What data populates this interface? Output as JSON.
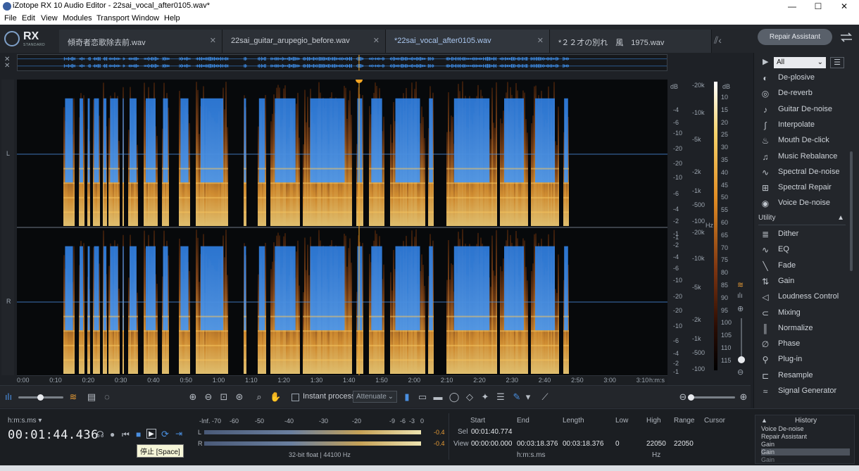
{
  "window": {
    "title": "iZotope RX 10 Audio Editor - 22sai_vocal_after0105.wav*",
    "minimize": "—",
    "maximize": "☐",
    "close": "✕"
  },
  "menu": [
    "File",
    "Edit",
    "View",
    "Modules",
    "Transport",
    "Window",
    "Help"
  ],
  "logo": {
    "text": "RX",
    "edition": "STANDARD"
  },
  "tabs": [
    {
      "label": "傾奇者恋歌除去前.wav",
      "active": false
    },
    {
      "label": "22sai_guitar_arupegio_before.wav",
      "active": false
    },
    {
      "label": "*22sai_vocal_after0105.wav",
      "active": true
    },
    {
      "label": "*２２才の別れ　風　1975.wav",
      "active": false
    }
  ],
  "repair_assistant": "Repair Assistant",
  "channels": {
    "left": "L",
    "right": "R"
  },
  "db_scale_label": "dB",
  "db_scale_top": [
    "-4",
    "-6",
    "-10",
    "-20",
    "-20",
    "-10",
    "-6",
    "-4",
    "-2",
    "-1"
  ],
  "db_scale_bottom": [
    "-1",
    "-2",
    "-4",
    "-6",
    "-10",
    "-20",
    "-20",
    "-10",
    "-6",
    "-4",
    "-2",
    "-1"
  ],
  "hz_scale_top": [
    "-20k",
    "-10k",
    "-5k",
    "-2k",
    "-1k",
    "-500",
    "-100"
  ],
  "hz_scale_bottom": [
    "-20k",
    "-10k",
    "-5k",
    "-2k",
    "-1k",
    "-500",
    "-100"
  ],
  "hz_unit": "Hz",
  "colorbar_label": "dB",
  "colorbar_ticks": [
    "10",
    "15",
    "20",
    "25",
    "30",
    "35",
    "40",
    "45",
    "50",
    "55",
    "60",
    "65",
    "70",
    "75",
    "80",
    "85",
    "90",
    "95",
    "100",
    "105",
    "110",
    "115"
  ],
  "timeline": [
    "0:00",
    "0:10",
    "0:20",
    "0:30",
    "0:40",
    "0:50",
    "1:00",
    "1:10",
    "1:20",
    "1:30",
    "1:40",
    "1:50",
    "2:00",
    "2:10",
    "2:20",
    "2:30",
    "2:40",
    "2:50",
    "3:00",
    "3:10"
  ],
  "timeline_unit": "h:m:s",
  "toolbar": {
    "instant_process": "Instant process",
    "attenuate": "Attenuate"
  },
  "modules_filter": "All",
  "modules": [
    {
      "name": "De-plosive",
      "icon": "deplosive-icon",
      "glyph": "◐"
    },
    {
      "name": "De-reverb",
      "icon": "dereverb-icon",
      "glyph": "◎"
    },
    {
      "name": "Guitar De-noise",
      "icon": "guitar-icon",
      "glyph": "♪"
    },
    {
      "name": "Interpolate",
      "icon": "interpolate-icon",
      "glyph": "∫"
    },
    {
      "name": "Mouth De-click",
      "icon": "mouth-icon",
      "glyph": "♨"
    },
    {
      "name": "Music Rebalance",
      "icon": "rebalance-icon",
      "glyph": "♫"
    },
    {
      "name": "Spectral De-noise",
      "icon": "spectral-denoise-icon",
      "glyph": "∿"
    },
    {
      "name": "Spectral Repair",
      "icon": "spectral-repair-icon",
      "glyph": "⊞"
    },
    {
      "name": "Voice De-noise",
      "icon": "voice-icon",
      "glyph": "◉"
    }
  ],
  "utility_header": "Utility",
  "utility_modules": [
    {
      "name": "Dither",
      "icon": "dither-icon",
      "glyph": "≣"
    },
    {
      "name": "EQ",
      "icon": "eq-icon",
      "glyph": "∿"
    },
    {
      "name": "Fade",
      "icon": "fade-icon",
      "glyph": "╲"
    },
    {
      "name": "Gain",
      "icon": "gain-icon",
      "glyph": "⇅"
    },
    {
      "name": "Loudness Control",
      "icon": "loudness-icon",
      "glyph": "◁"
    },
    {
      "name": "Mixing",
      "icon": "mixing-icon",
      "glyph": "⊂"
    },
    {
      "name": "Normalize",
      "icon": "normalize-icon",
      "glyph": "║"
    },
    {
      "name": "Phase",
      "icon": "phase-icon",
      "glyph": "∅"
    },
    {
      "name": "Plug-in",
      "icon": "plugin-icon",
      "glyph": "⚲"
    },
    {
      "name": "Resample",
      "icon": "resample-icon",
      "glyph": "⊏"
    },
    {
      "name": "Signal Generator",
      "icon": "signal-icon",
      "glyph": "≈"
    }
  ],
  "transport": {
    "time_format": "h:m:s.ms",
    "time": "00:01:44.436",
    "tooltip": "停止 [Space]"
  },
  "meter": {
    "ticks": [
      "-Inf.",
      "-70",
      "-60",
      "-50",
      "-40",
      "-30",
      "-20",
      "-9",
      "-6",
      "-3",
      "0"
    ],
    "left_label": "L",
    "right_label": "R",
    "left_peak": "-0.4",
    "right_peak": "-0.4",
    "format": "32-bit float | 44100 Hz"
  },
  "selection": {
    "headers": {
      "start": "Start",
      "end": "End",
      "length": "Length",
      "low": "Low",
      "high": "High",
      "range": "Range",
      "cursor": "Cursor"
    },
    "sel_label": "Sel",
    "view_label": "View",
    "sel_start": "00:01:40.774",
    "view_start": "00:00:00.000",
    "view_end": "00:03:18.376",
    "view_length": "00:03:18.376",
    "low": "0",
    "high": "22050",
    "range": "22050",
    "time_unit": "h:m:s.ms",
    "freq_unit": "Hz"
  },
  "history": {
    "title": "History",
    "items": [
      "Voice De-noise",
      "Repair Assistant",
      "Gain",
      "Gain",
      "Gain"
    ]
  },
  "colors": {
    "accent": "#4a8fe0",
    "playhead": "#f5a623",
    "waveform": "#3f8ee8"
  }
}
